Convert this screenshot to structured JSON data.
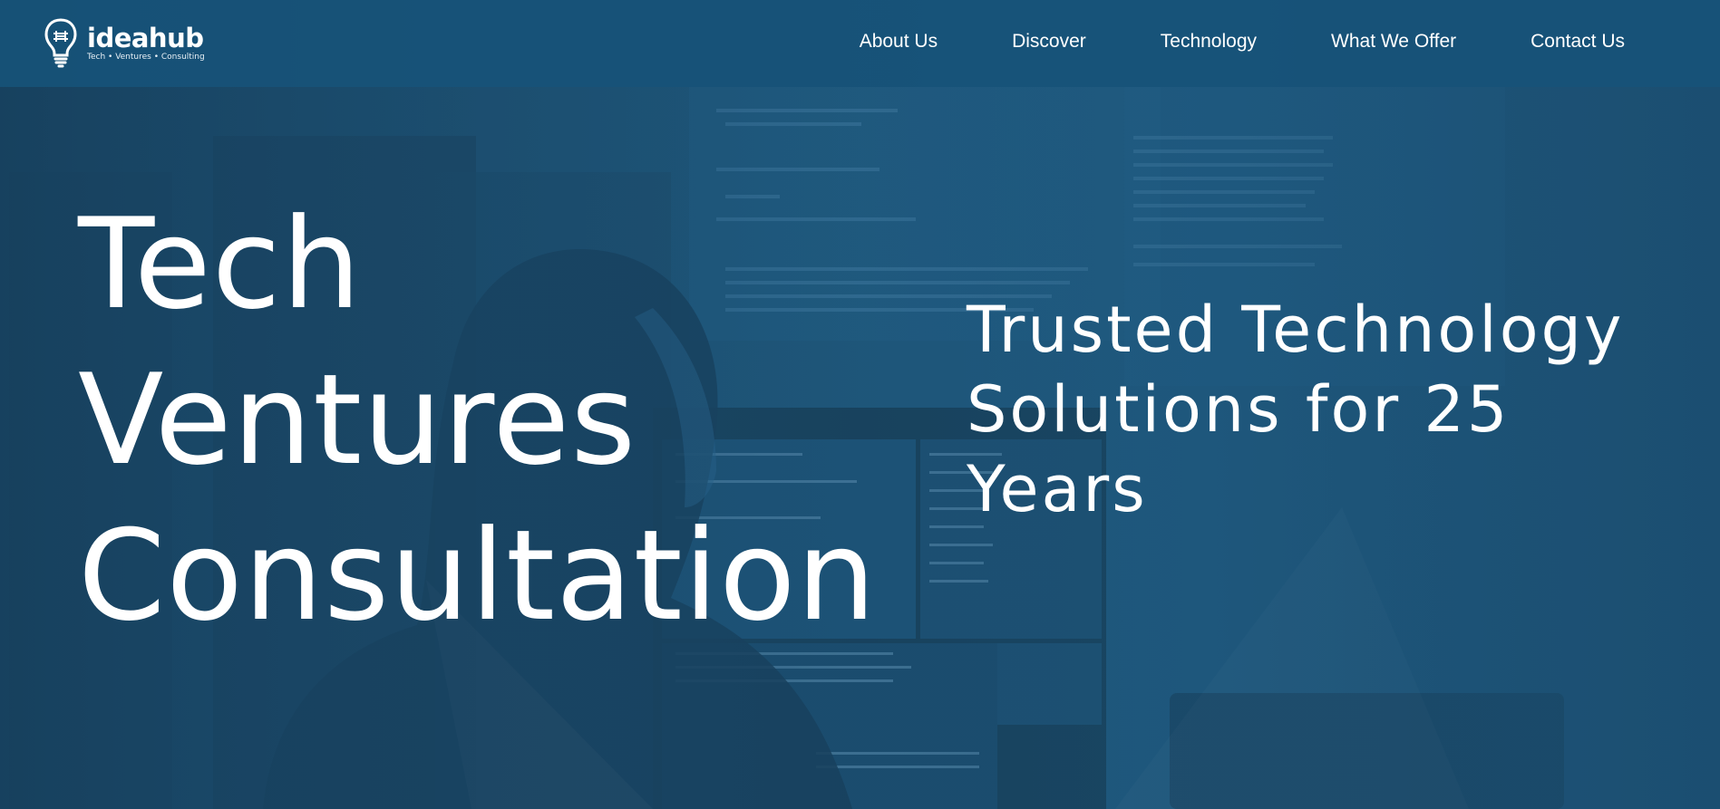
{
  "brand": {
    "name": "ideahub",
    "tagline": "Tech • Ventures • Consulting"
  },
  "nav": {
    "items": [
      {
        "label": "About Us"
      },
      {
        "label": "Discover"
      },
      {
        "label": "Technology"
      },
      {
        "label": "What We Offer"
      },
      {
        "label": "Contact Us"
      }
    ]
  },
  "hero": {
    "title_lines": [
      "Tech",
      "Ventures",
      "Consultation"
    ],
    "subtitle": "Trusted Technology Solutions for 25 Years"
  },
  "colors": {
    "header_bg": "#175278",
    "hero_overlay": "#1e5578",
    "text": "#ffffff"
  },
  "icons": {
    "logo": "lightbulb-logo-icon"
  }
}
